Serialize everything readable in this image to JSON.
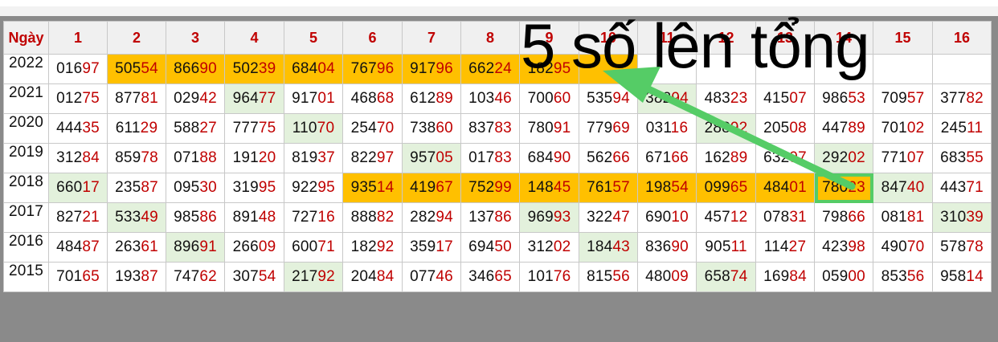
{
  "header": {
    "corner": "Ngày",
    "days": [
      "1",
      "2",
      "3",
      "4",
      "5",
      "6",
      "7",
      "8",
      "9",
      "10",
      "11",
      "12",
      "13",
      "14",
      "15",
      "16"
    ]
  },
  "rows": [
    {
      "year": "2022",
      "cells": [
        {
          "h": "016",
          "t": "97",
          "hl": ""
        },
        {
          "h": "505",
          "t": "54",
          "hl": "o"
        },
        {
          "h": "866",
          "t": "90",
          "hl": "o"
        },
        {
          "h": "502",
          "t": "39",
          "hl": "o"
        },
        {
          "h": "684",
          "t": "04",
          "hl": "o"
        },
        {
          "h": "767",
          "t": "96",
          "hl": "o"
        },
        {
          "h": "917",
          "t": "96",
          "hl": "o"
        },
        {
          "h": "662",
          "t": "24",
          "hl": "o"
        },
        {
          "h": "182",
          "t": "95",
          "hl": "o"
        },
        {
          "h": "",
          "t": "",
          "hl": "o"
        },
        {
          "h": "",
          "t": "",
          "hl": ""
        },
        {
          "h": "",
          "t": "",
          "hl": ""
        },
        {
          "h": "",
          "t": "",
          "hl": ""
        },
        {
          "h": "",
          "t": "",
          "hl": ""
        },
        {
          "h": "",
          "t": "",
          "hl": ""
        },
        {
          "h": "",
          "t": "",
          "hl": ""
        }
      ]
    },
    {
      "year": "2021",
      "cells": [
        {
          "h": "012",
          "t": "75",
          "hl": ""
        },
        {
          "h": "877",
          "t": "81",
          "hl": ""
        },
        {
          "h": "029",
          "t": "42",
          "hl": ""
        },
        {
          "h": "964",
          "t": "77",
          "hl": "g"
        },
        {
          "h": "917",
          "t": "01",
          "hl": ""
        },
        {
          "h": "468",
          "t": "68",
          "hl": ""
        },
        {
          "h": "612",
          "t": "89",
          "hl": ""
        },
        {
          "h": "103",
          "t": "46",
          "hl": ""
        },
        {
          "h": "700",
          "t": "60",
          "hl": ""
        },
        {
          "h": "535",
          "t": "94",
          "hl": ""
        },
        {
          "h": "382",
          "t": "94",
          "hl": "g"
        },
        {
          "h": "483",
          "t": "23",
          "hl": ""
        },
        {
          "h": "415",
          "t": "07",
          "hl": ""
        },
        {
          "h": "986",
          "t": "53",
          "hl": ""
        },
        {
          "h": "709",
          "t": "57",
          "hl": ""
        },
        {
          "h": "377",
          "t": "82",
          "hl": ""
        }
      ]
    },
    {
      "year": "2020",
      "cells": [
        {
          "h": "444",
          "t": "35",
          "hl": ""
        },
        {
          "h": "611",
          "t": "29",
          "hl": ""
        },
        {
          "h": "588",
          "t": "27",
          "hl": ""
        },
        {
          "h": "777",
          "t": "75",
          "hl": ""
        },
        {
          "h": "110",
          "t": "70",
          "hl": "g"
        },
        {
          "h": "254",
          "t": "70",
          "hl": ""
        },
        {
          "h": "738",
          "t": "60",
          "hl": ""
        },
        {
          "h": "837",
          "t": "83",
          "hl": ""
        },
        {
          "h": "780",
          "t": "91",
          "hl": ""
        },
        {
          "h": "779",
          "t": "69",
          "hl": ""
        },
        {
          "h": "031",
          "t": "16",
          "hl": ""
        },
        {
          "h": "288",
          "t": "92",
          "hl": "g"
        },
        {
          "h": "205",
          "t": "08",
          "hl": ""
        },
        {
          "h": "447",
          "t": "89",
          "hl": ""
        },
        {
          "h": "701",
          "t": "02",
          "hl": ""
        },
        {
          "h": "245",
          "t": "11",
          "hl": ""
        }
      ]
    },
    {
      "year": "2019",
      "cells": [
        {
          "h": "312",
          "t": "84",
          "hl": ""
        },
        {
          "h": "859",
          "t": "78",
          "hl": ""
        },
        {
          "h": "071",
          "t": "88",
          "hl": ""
        },
        {
          "h": "191",
          "t": "20",
          "hl": ""
        },
        {
          "h": "819",
          "t": "37",
          "hl": ""
        },
        {
          "h": "822",
          "t": "97",
          "hl": ""
        },
        {
          "h": "957",
          "t": "05",
          "hl": "g"
        },
        {
          "h": "017",
          "t": "83",
          "hl": ""
        },
        {
          "h": "684",
          "t": "90",
          "hl": ""
        },
        {
          "h": "562",
          "t": "66",
          "hl": ""
        },
        {
          "h": "671",
          "t": "66",
          "hl": ""
        },
        {
          "h": "162",
          "t": "89",
          "hl": ""
        },
        {
          "h": "632",
          "t": "97",
          "hl": ""
        },
        {
          "h": "292",
          "t": "02",
          "hl": "g"
        },
        {
          "h": "771",
          "t": "07",
          "hl": ""
        },
        {
          "h": "683",
          "t": "55",
          "hl": ""
        }
      ]
    },
    {
      "year": "2018",
      "cells": [
        {
          "h": "660",
          "t": "17",
          "hl": "g"
        },
        {
          "h": "235",
          "t": "87",
          "hl": ""
        },
        {
          "h": "095",
          "t": "30",
          "hl": ""
        },
        {
          "h": "319",
          "t": "95",
          "hl": ""
        },
        {
          "h": "922",
          "t": "95",
          "hl": ""
        },
        {
          "h": "935",
          "t": "14",
          "hl": "o"
        },
        {
          "h": "419",
          "t": "67",
          "hl": "o"
        },
        {
          "h": "752",
          "t": "99",
          "hl": "o"
        },
        {
          "h": "148",
          "t": "45",
          "hl": "o"
        },
        {
          "h": "761",
          "t": "57",
          "hl": "o"
        },
        {
          "h": "198",
          "t": "54",
          "hl": "o"
        },
        {
          "h": "099",
          "t": "65",
          "hl": "o"
        },
        {
          "h": "484",
          "t": "01",
          "hl": "o"
        },
        {
          "h": "780",
          "t": "23",
          "hl": "b"
        },
        {
          "h": "847",
          "t": "40",
          "hl": "g"
        },
        {
          "h": "443",
          "t": "71",
          "hl": ""
        }
      ]
    },
    {
      "year": "2017",
      "cells": [
        {
          "h": "827",
          "t": "21",
          "hl": ""
        },
        {
          "h": "533",
          "t": "49",
          "hl": "g"
        },
        {
          "h": "985",
          "t": "86",
          "hl": ""
        },
        {
          "h": "891",
          "t": "48",
          "hl": ""
        },
        {
          "h": "727",
          "t": "16",
          "hl": ""
        },
        {
          "h": "888",
          "t": "82",
          "hl": ""
        },
        {
          "h": "282",
          "t": "94",
          "hl": ""
        },
        {
          "h": "137",
          "t": "86",
          "hl": ""
        },
        {
          "h": "969",
          "t": "93",
          "hl": "g"
        },
        {
          "h": "322",
          "t": "47",
          "hl": ""
        },
        {
          "h": "690",
          "t": "10",
          "hl": ""
        },
        {
          "h": "457",
          "t": "12",
          "hl": ""
        },
        {
          "h": "078",
          "t": "31",
          "hl": ""
        },
        {
          "h": "798",
          "t": "66",
          "hl": ""
        },
        {
          "h": "081",
          "t": "81",
          "hl": ""
        },
        {
          "h": "310",
          "t": "39",
          "hl": "g"
        }
      ]
    },
    {
      "year": "2016",
      "cells": [
        {
          "h": "484",
          "t": "87",
          "hl": ""
        },
        {
          "h": "263",
          "t": "61",
          "hl": ""
        },
        {
          "h": "896",
          "t": "91",
          "hl": "g"
        },
        {
          "h": "266",
          "t": "09",
          "hl": ""
        },
        {
          "h": "600",
          "t": "71",
          "hl": ""
        },
        {
          "h": "182",
          "t": "92",
          "hl": ""
        },
        {
          "h": "359",
          "t": "17",
          "hl": ""
        },
        {
          "h": "694",
          "t": "50",
          "hl": ""
        },
        {
          "h": "312",
          "t": "02",
          "hl": ""
        },
        {
          "h": "184",
          "t": "43",
          "hl": "g"
        },
        {
          "h": "836",
          "t": "90",
          "hl": ""
        },
        {
          "h": "905",
          "t": "11",
          "hl": ""
        },
        {
          "h": "114",
          "t": "27",
          "hl": ""
        },
        {
          "h": "423",
          "t": "98",
          "hl": ""
        },
        {
          "h": "490",
          "t": "70",
          "hl": ""
        },
        {
          "h": "578",
          "t": "78",
          "hl": ""
        }
      ]
    },
    {
      "year": "2015",
      "cells": [
        {
          "h": "701",
          "t": "65",
          "hl": ""
        },
        {
          "h": "193",
          "t": "87",
          "hl": ""
        },
        {
          "h": "747",
          "t": "62",
          "hl": ""
        },
        {
          "h": "307",
          "t": "54",
          "hl": ""
        },
        {
          "h": "217",
          "t": "92",
          "hl": "g"
        },
        {
          "h": "204",
          "t": "84",
          "hl": ""
        },
        {
          "h": "077",
          "t": "46",
          "hl": ""
        },
        {
          "h": "346",
          "t": "65",
          "hl": ""
        },
        {
          "h": "101",
          "t": "76",
          "hl": ""
        },
        {
          "h": "815",
          "t": "56",
          "hl": ""
        },
        {
          "h": "480",
          "t": "09",
          "hl": ""
        },
        {
          "h": "658",
          "t": "74",
          "hl": "g"
        },
        {
          "h": "169",
          "t": "84",
          "hl": ""
        },
        {
          "h": "059",
          "t": "00",
          "hl": ""
        },
        {
          "h": "853",
          "t": "56",
          "hl": ""
        },
        {
          "h": "958",
          "t": "14",
          "hl": ""
        }
      ]
    }
  ],
  "annotation": {
    "text": "5 số lên tổng",
    "arrow_color": "#55cc66"
  }
}
